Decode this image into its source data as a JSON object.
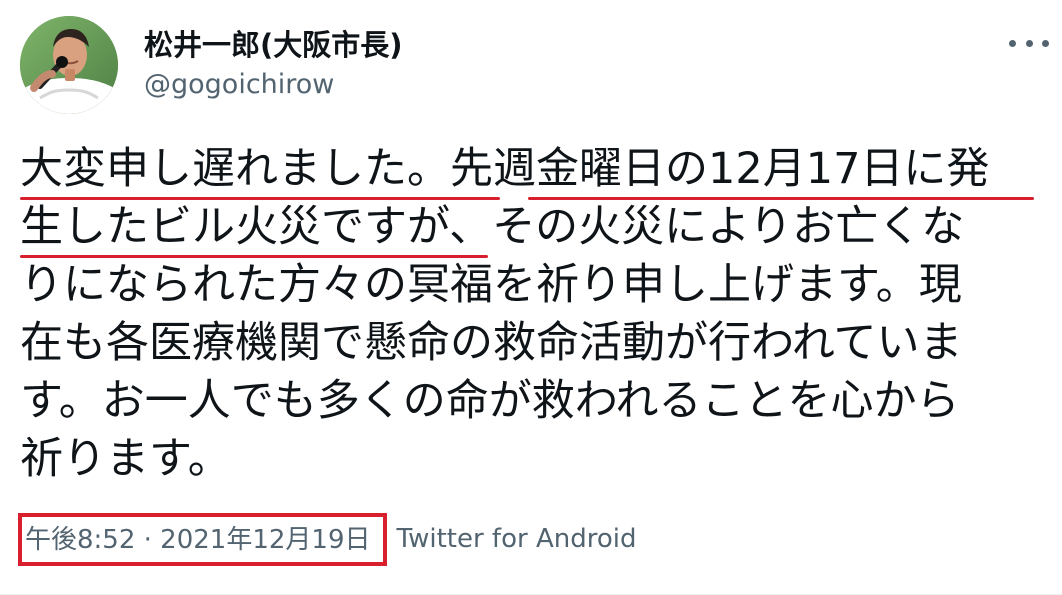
{
  "user": {
    "display_name": "松井一郎(大阪市長)",
    "handle": "@gogoichirow",
    "avatar_icon": "profile-photo-icon"
  },
  "menu": {
    "more_icon": "ellipsis-horizontal-icon"
  },
  "tweet": {
    "lines": [
      "大変申し遅れました。先週金曜日の12月17日に発",
      "生したビル火災ですが、その火災によりお亡くな",
      "りになられた方々の冥福を祈り申し上げます。現",
      "在も各医療機関で懸命の救命活動が行われていま",
      "す。お一人でも多くの命が救われることを心から",
      "祈ります。"
    ]
  },
  "meta": {
    "timestamp": "午後8:52 · 2021年12月19日",
    "source": "Twitter for Android"
  },
  "colors": {
    "annotation": "#d71f2d",
    "secondary_text": "#536471",
    "primary_text": "#0f1419",
    "background": "#ffffff"
  }
}
